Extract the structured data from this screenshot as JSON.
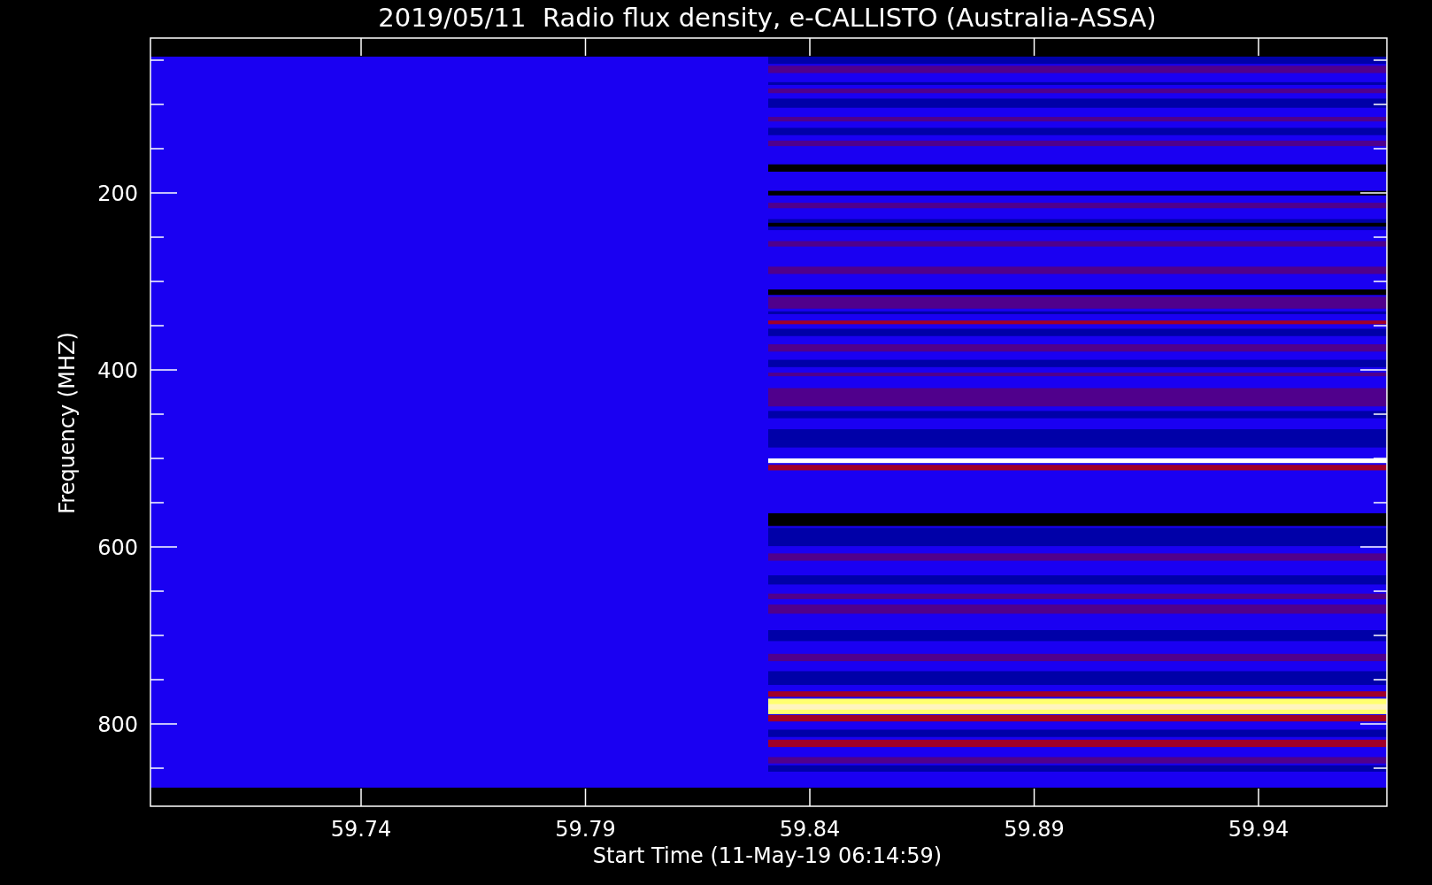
{
  "title": "2019/05/11  Radio flux density, e-CALLISTO (Australia-ASSA)",
  "x_axis": {
    "label": "Start Time (11-May-19 06:14:59)",
    "tick_labels": [
      "59.74",
      "59.79",
      "59.84",
      "59.89",
      "59.94"
    ]
  },
  "y_axis": {
    "label": "Frequency (MHZ)",
    "tick_labels": [
      "200",
      "400",
      "600",
      "800"
    ]
  }
}
